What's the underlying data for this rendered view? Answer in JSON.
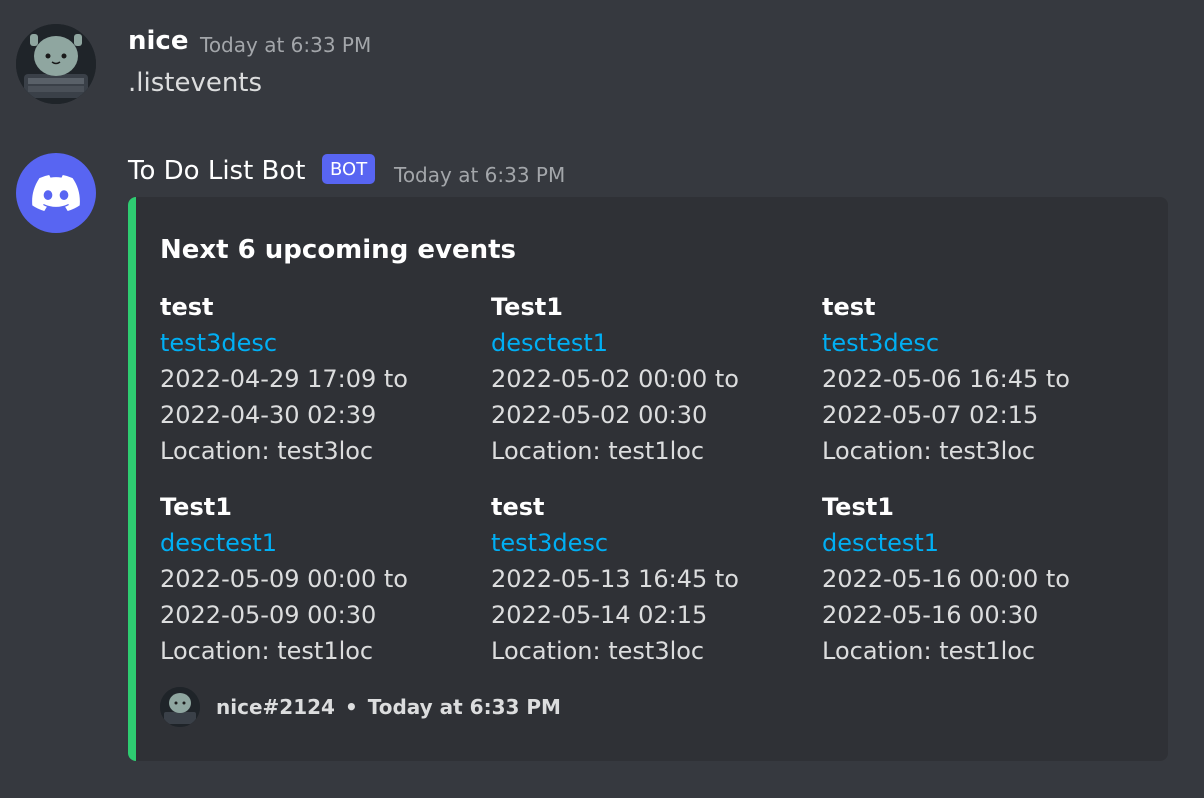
{
  "user_message": {
    "author": "nice",
    "timestamp": "Today at 6:33 PM",
    "content": ".listevents"
  },
  "bot_message": {
    "author": "To Do List Bot",
    "tag": "BOT",
    "timestamp": "Today at 6:33 PM"
  },
  "embed": {
    "title": "Next 6 upcoming events",
    "accent_color": "#2ecc71",
    "fields": [
      {
        "name": "test",
        "desc": "test3desc",
        "start": "2022-04-29 17:09 to",
        "end": "2022-04-30 02:39",
        "location": "Location: test3loc"
      },
      {
        "name": "Test1",
        "desc": "desctest1",
        "start": "2022-05-02 00:00 to",
        "end": "2022-05-02 00:30",
        "location": "Location: test1loc"
      },
      {
        "name": "test",
        "desc": "test3desc",
        "start": "2022-05-06 16:45 to",
        "end": "2022-05-07 02:15",
        "location": "Location: test3loc"
      },
      {
        "name": "Test1",
        "desc": "desctest1",
        "start": "2022-05-09 00:00 to",
        "end": "2022-05-09 00:30",
        "location": "Location: test1loc"
      },
      {
        "name": "test",
        "desc": "test3desc",
        "start": "2022-05-13 16:45 to",
        "end": "2022-05-14 02:15",
        "location": "Location: test3loc"
      },
      {
        "name": "Test1",
        "desc": "desctest1",
        "start": "2022-05-16 00:00 to",
        "end": "2022-05-16 00:30",
        "location": "Location: test1loc"
      }
    ],
    "footer": {
      "author": "nice#2124",
      "separator": "•",
      "timestamp": "Today at 6:33 PM"
    }
  },
  "icons": {
    "user_avatar": "robot-avatar-icon",
    "bot_avatar": "discord-logo-icon"
  },
  "colors": {
    "background": "#36393f",
    "embed_background": "#2f3136",
    "link": "#00aff4",
    "bot_tag": "#5865f2"
  }
}
